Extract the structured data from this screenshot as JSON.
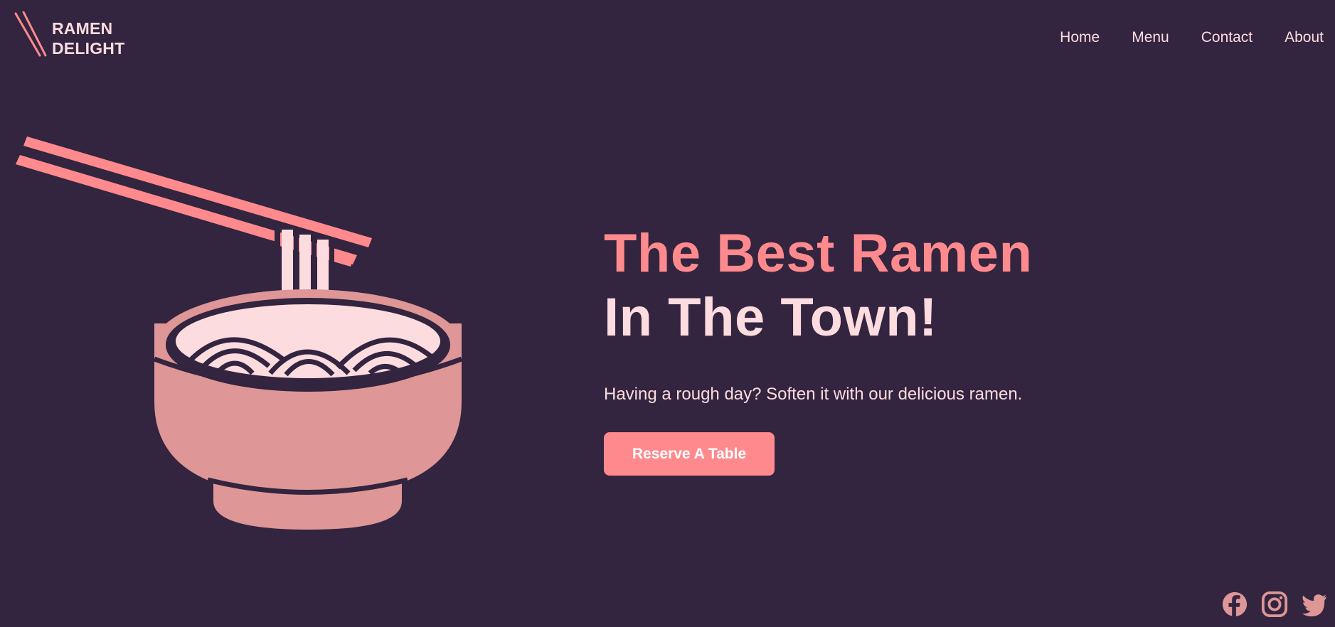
{
  "brand": {
    "line1": "RAMEN",
    "line2": "DELIGHT"
  },
  "nav": {
    "items": [
      {
        "label": "Home"
      },
      {
        "label": "Menu"
      },
      {
        "label": "Contact"
      },
      {
        "label": "About"
      }
    ]
  },
  "hero": {
    "title_line1": "The Best Ramen",
    "title_line2": "In The Town!",
    "subtitle": "Having a rough day? Soften it with our delicious ramen.",
    "cta_label": "Reserve A Table"
  },
  "social": {
    "icons": [
      "facebook-icon",
      "instagram-icon",
      "twitter-icon"
    ]
  },
  "colors": {
    "background": "#33243f",
    "accent": "#ff8a8d",
    "light": "#fcdcdf",
    "bowl": "#de9696"
  }
}
